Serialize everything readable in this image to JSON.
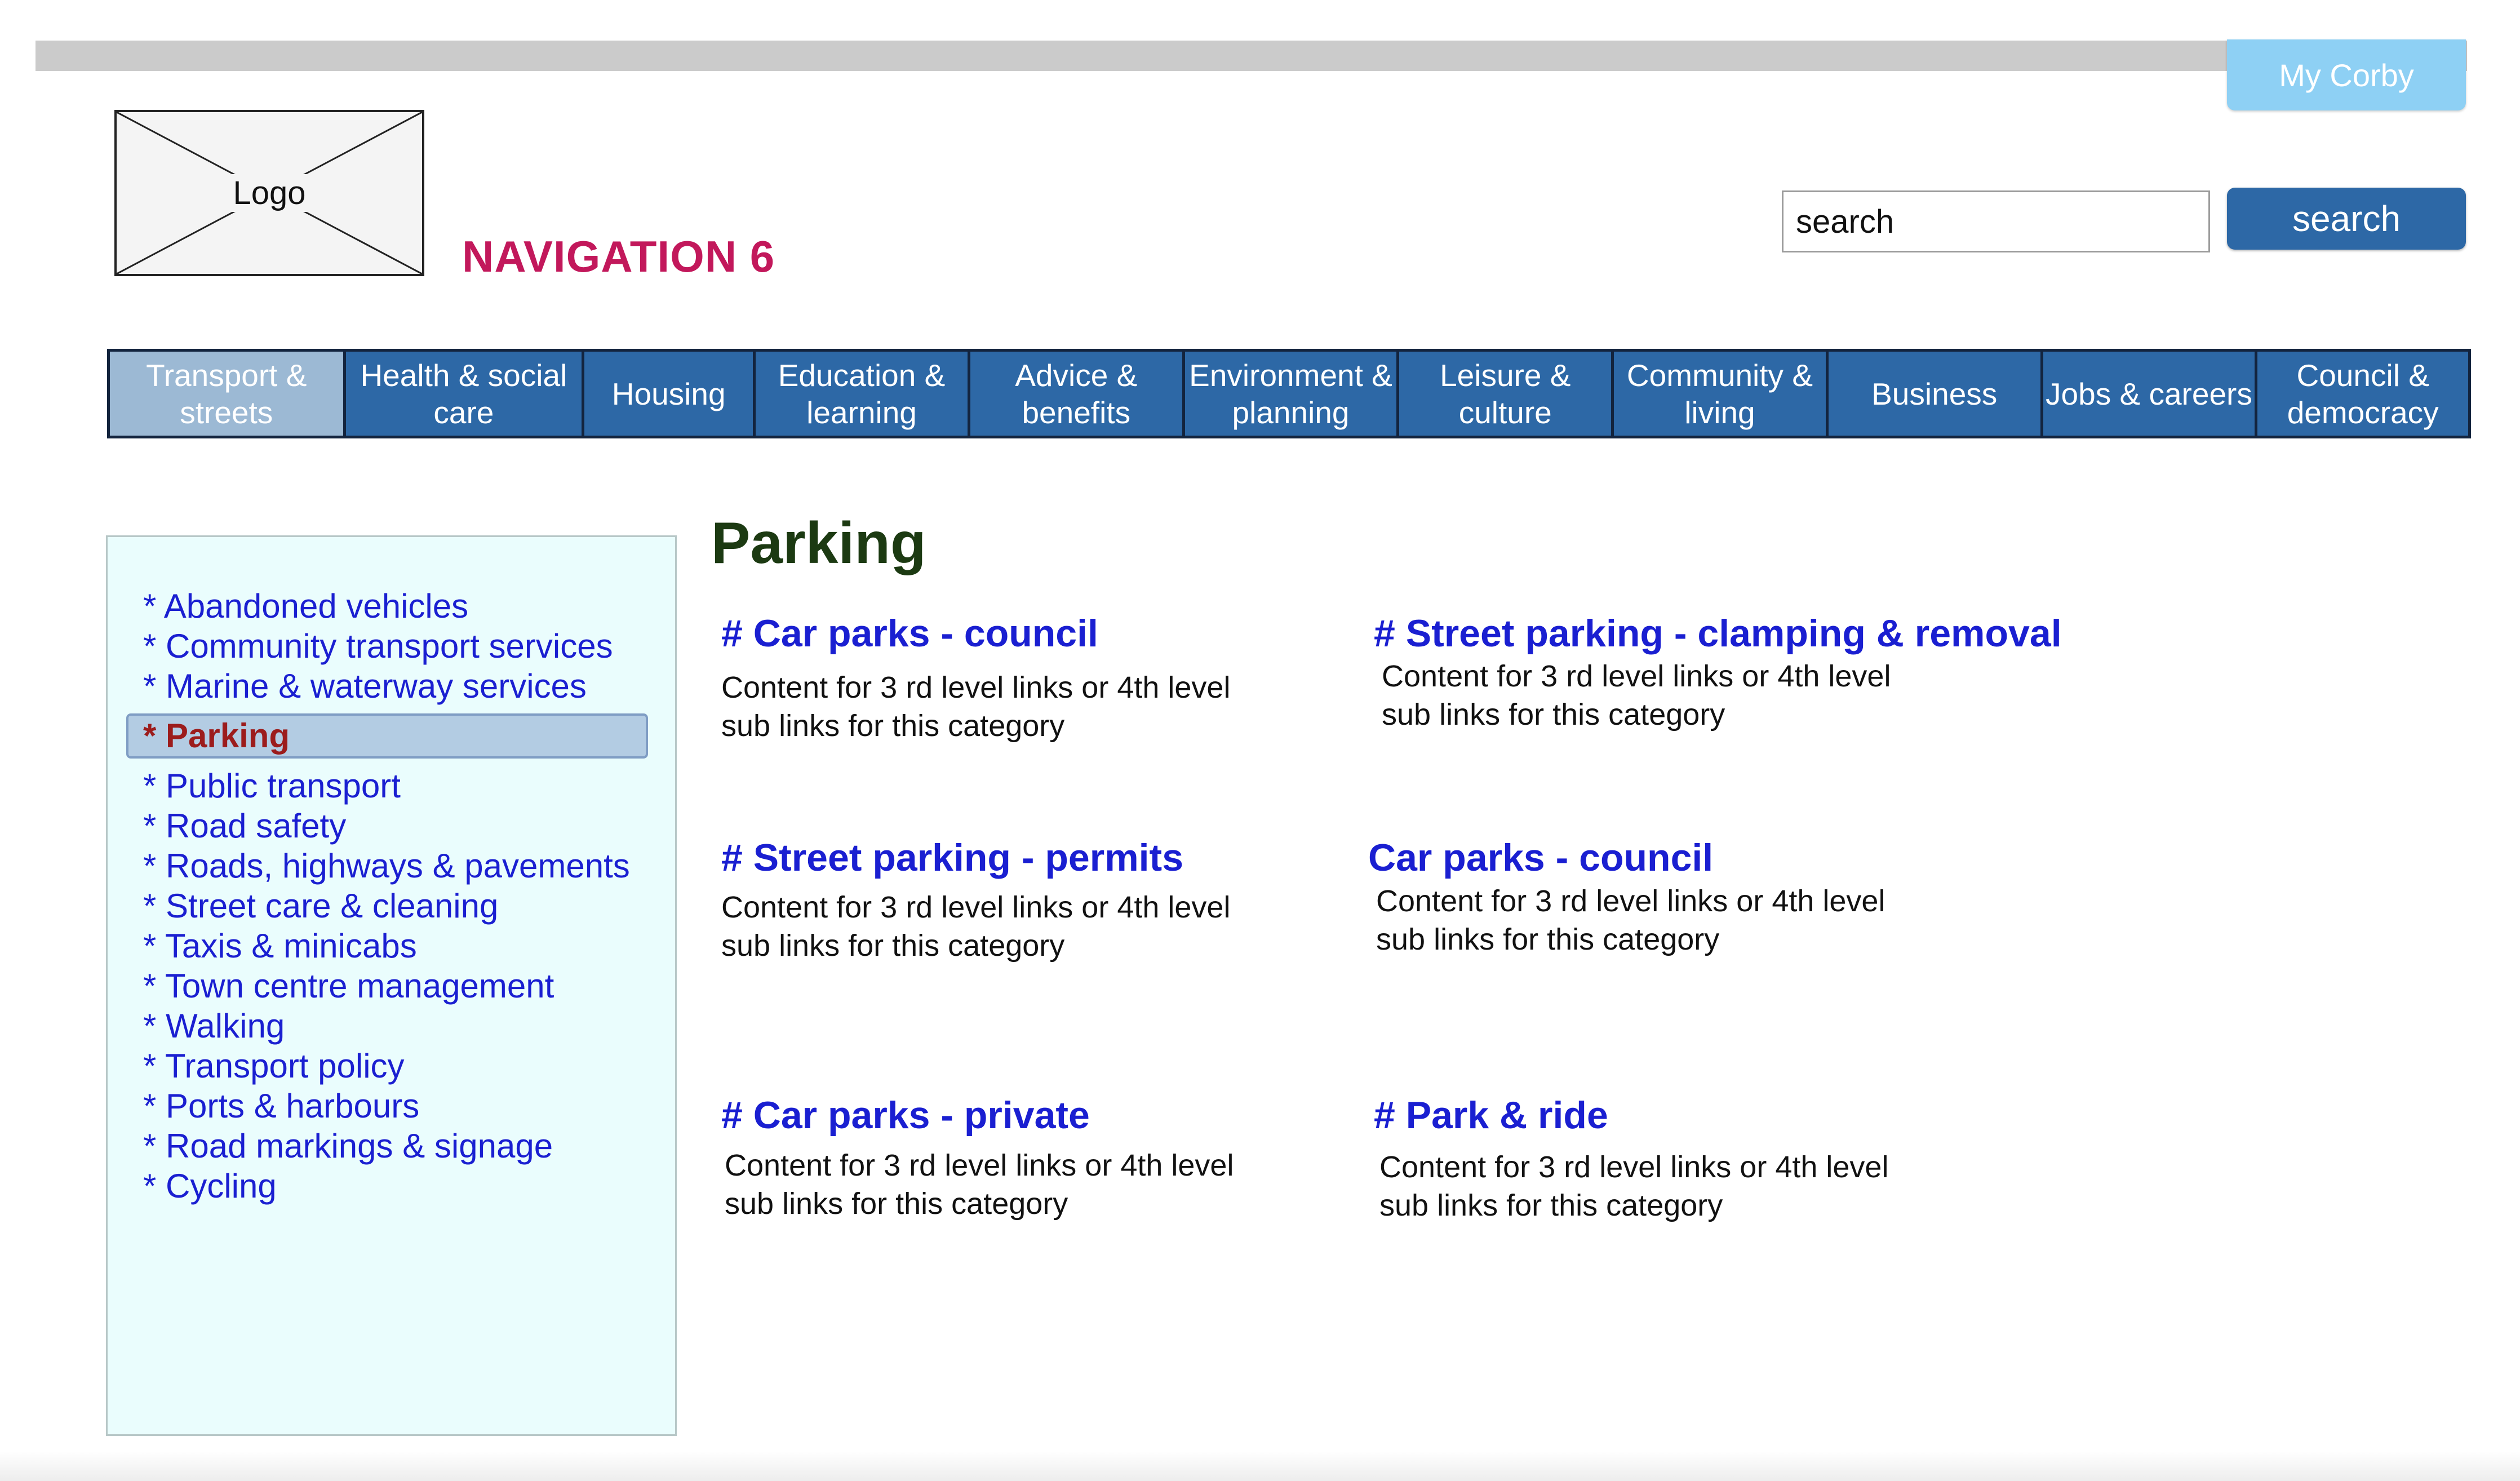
{
  "header": {
    "my_account_label": "My Corby",
    "logo_label": "Logo",
    "nav_title": "NAVIGATION 6",
    "search_value": "search",
    "search_button_label": "search"
  },
  "nav": [
    {
      "label": "Transport &\nstreets",
      "active": true
    },
    {
      "label": "Health & social\ncare",
      "active": false
    },
    {
      "label": "Housing",
      "active": false
    },
    {
      "label": "Education &\nlearning",
      "active": false
    },
    {
      "label": "Advice &\nbenefits",
      "active": false
    },
    {
      "label": "Environment &\nplanning",
      "active": false
    },
    {
      "label": "Leisure &\nculture",
      "active": false
    },
    {
      "label": "Community &\nliving",
      "active": false
    },
    {
      "label": "Business",
      "active": false
    },
    {
      "label": "Jobs & careers",
      "active": false
    },
    {
      "label": "Council &\ndemocracy",
      "active": false
    }
  ],
  "sidebar": {
    "items": [
      {
        "label": "* Abandoned vehicles",
        "active": false
      },
      {
        "label": "* Community transport services",
        "active": false
      },
      {
        "label": "* Marine & waterway services",
        "active": false
      },
      {
        "label": "* Parking",
        "active": true
      },
      {
        "label": "* Public transport",
        "active": false
      },
      {
        "label": "* Road safety",
        "active": false
      },
      {
        "label": "* Roads, highways & pavements",
        "active": false
      },
      {
        "label": "* Street care & cleaning",
        "active": false
      },
      {
        "label": "* Taxis & minicabs",
        "active": false
      },
      {
        "label": "* Town centre management",
        "active": false
      },
      {
        "label": "* Walking",
        "active": false
      },
      {
        "label": "* Transport policy",
        "active": false
      },
      {
        "label": "* Ports & harbours",
        "active": false
      },
      {
        "label": "* Road markings & signage",
        "active": false
      },
      {
        "label": "* Cycling",
        "active": false
      }
    ]
  },
  "main": {
    "heading": "Parking",
    "categories": [
      {
        "title": "# Car parks - council",
        "description": "Content for 3 rd level links or 4th level sub links for this category"
      },
      {
        "title": "# Street parking - clamping & removal",
        "description": "Content for 3 rd level links or 4th level sub links for this category"
      },
      {
        "title": "# Street parking - permits",
        "description": "Content for 3 rd level links or 4th level sub links for this category"
      },
      {
        "title": "Car parks - council",
        "description": "Content for 3 rd level links or 4th level sub links for this category"
      },
      {
        "title": "# Car parks - private",
        "description": "Content for 3 rd level links or 4th level sub links for this category"
      },
      {
        "title": "# Park & ride",
        "description": "Content for 3 rd level links or 4th level sub links for this category"
      }
    ]
  },
  "colors": {
    "nav_bg": "#2d68a6",
    "nav_active_bg": "#9cb9d4",
    "link_blue": "#1a1fd1",
    "nav_title": "#c2185b",
    "heading": "#1c3a12",
    "sidebar_bg": "#eafdfd",
    "my_account_bg": "#8ed0f4"
  }
}
